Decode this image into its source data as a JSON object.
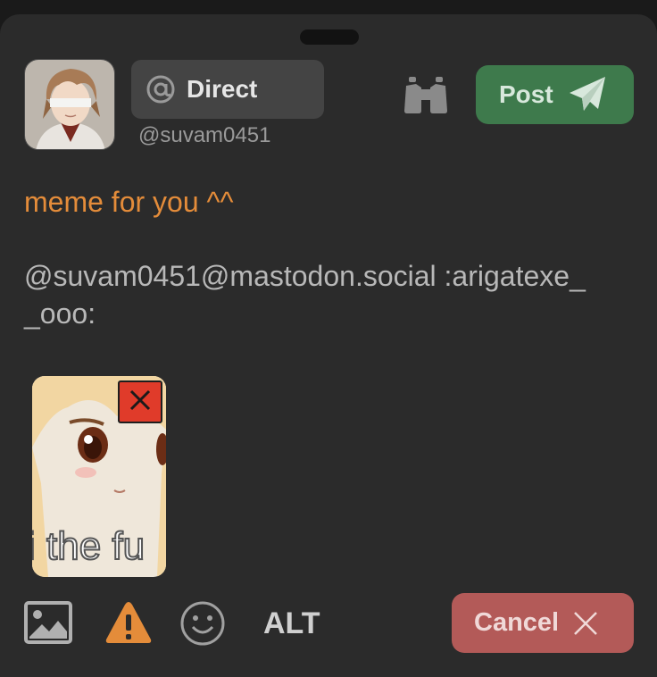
{
  "composer": {
    "visibility_label": "Direct",
    "handle": "@suvam0451",
    "post_label": "Post",
    "cancel_label": "Cancel",
    "alt_label": "ALT",
    "text_line1": "meme for you ^^",
    "text_line2": "@suvam0451@mastodon.social :arigatexe_\n_ooo:",
    "attachment_caption": "i the fu"
  },
  "icons": {
    "visibility": "at-icon",
    "search": "binoculars-icon",
    "send": "paper-plane-icon",
    "remove": "close-icon",
    "media": "image-icon",
    "content_warning": "warning-icon",
    "emoji": "emoji-icon",
    "cancel": "close-icon"
  },
  "colors": {
    "post": "#3e7a4c",
    "cancel": "#b35a58",
    "text_primary": "#e48c3a",
    "warning": "#e48c3a",
    "remove": "#e03b2a"
  }
}
